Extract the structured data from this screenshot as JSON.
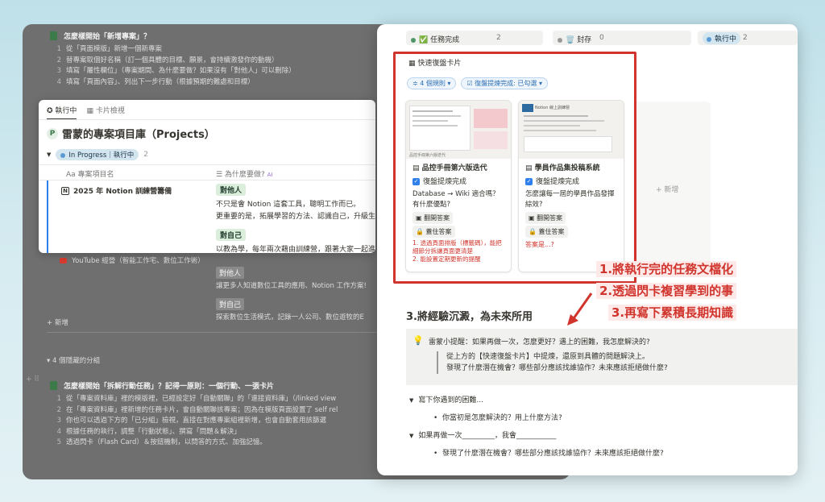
{
  "left": {
    "section1": {
      "title": "怎麼樣開始「新增專案」？",
      "items": [
        "從「頁面模版」新增一個新專案",
        "替專案取個好名稱（訂一個具體的目標、願景，會持續激發你的動機）",
        "填寫「屬性欄位」（專案期間、為什麼要做？如果沒有「對他人」可以刪除）",
        "填寫「頁面內容」、列出下一步行動（根據預期的難處和目標）"
      ]
    },
    "card": {
      "tabs": [
        "執行中",
        "卡片檢視"
      ],
      "db_title": "雷蒙的專案項目庫（Projects）",
      "group_label": "In Progress｜執行中",
      "group_count": "2",
      "col_name": "專案項目名",
      "col_why": "為什麼要做?",
      "col_ai": "AI",
      "row_title": "2025 年 Notion 訓練營籌備",
      "tag_others": "對他人",
      "text_others_1": "不只是會 Notion 這套工具，聰明工作而已。",
      "text_others_2": "更重要的是，拓展學習的方法、認識自己，升級生",
      "tag_self": "對自己",
      "text_self": "以教為學，每年兩次藉由訓練營，跟著大家一起進"
    },
    "row2": {
      "title": "YouTube 經營（智能工作宅、數位工作術）",
      "tag_others": "對他人",
      "text_others": "讓更多人知道數位工具的應用、Notion 工作方案!",
      "tag_self": "對自己",
      "text_self": "探索數位生活模式，記錄一人公司、數位遊牧的E"
    },
    "add_new": "+ 新增",
    "hidden_groups": "4 個隱藏的分組",
    "section2": {
      "title": "怎麼樣開始「拆解行動任務」？記得一原則：一個行動、一張卡片",
      "items": [
        "從「專案資料庫」裡的模版裡，已經設定好「自動關聯」的「連接資料庫」（/linked view",
        "在「專案資料庫」裡新增的任務卡片，會自動關聯該專案；因為在模版頁面設置了 self rel",
        "你也可以透過下方的「已分組」檢視，直接在對應專案組裡新增，也會自動套用該篩選",
        "根據任務的執行，調整「行動狀態」、撰寫「問題＆解決」",
        "透過閃卡（Flash Card）＆按鈕機制，以問答的方式、加強記憶。"
      ]
    }
  },
  "right": {
    "status_chips": [
      {
        "label": "✅ 任務完成",
        "count": "2",
        "dot_color": "#4f9768"
      },
      {
        "label": "🗑️ 封存",
        "count": "0",
        "dot_color": "#9b9a97"
      },
      {
        "label": "執行中",
        "count": "2",
        "dot_color": "#5a9bd5"
      }
    ],
    "view_title": "快速復盤卡片",
    "filter_rules": "4 個規則",
    "filter_done": "復盤提煉完成: 已勾選",
    "card1": {
      "title": "品控手冊第六版迭代",
      "checkbox": "復盤提煉完成",
      "question": "Database → Wiki 適合嗎？有什麼優點?",
      "pill1": "翻開答案",
      "pill2": "蓋住答案",
      "answers": [
        "1. 透過頁面排版（標籤碼），能把",
        "細節分拆讓頁面更清楚",
        "2. 能設置定期更新的提醒"
      ]
    },
    "card2": {
      "title": "學員作品集投稿系統",
      "checkbox": "復盤提煉完成",
      "question": "怎麼讓每一屆的學員作品發揮綜效?",
      "pill1": "翻開答案",
      "pill2": "蓋住答案",
      "answer": "答案是...?"
    },
    "add_new": "+ 新增",
    "thumb1_caption": "品控手冊第六版迭代",
    "thumb2_caption": "Notion 線上訓練營",
    "annotations": [
      "1.將執行完的任務文檔化",
      "2.透過閃卡複習學到的事",
      "3.再寫下累積長期知識"
    ],
    "section3_title": "3.將經驗沉澱，為未來所用",
    "callout": {
      "icon": "lightbulb-icon",
      "text": "雷蒙小提醒：如果再做一次，怎麼更好？遇上的困難，我怎麼解決的?",
      "quote1": "從上方的【快速復盤卡片】中提煉，還原到具體的問題解決上。",
      "quote2": "發現了什麼潛在機會？哪些部分應該找誰協作？未來應該拒絕做什麼?"
    },
    "toggles": [
      {
        "label": "寫下你遇到的困難...",
        "bullet": "你當初是怎麼解決的？用上什麼方法?"
      },
      {
        "label": "如果再做一次_________，我會___________",
        "bullet": "發現了什麼潛在機會？哪些部分應該找誰協作？未來應該拒絕做什麼?"
      }
    ]
  },
  "colors": {
    "accent_red": "#d0342c",
    "notion_blue": "#2f80ed",
    "tag_green": "#dbeddb"
  }
}
